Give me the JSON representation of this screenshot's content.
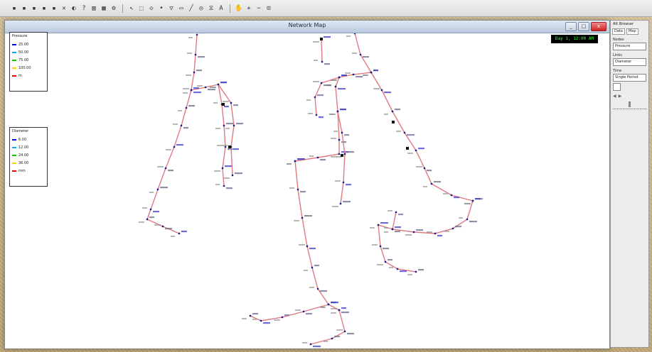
{
  "toolbar": {
    "icons": [
      "new-icon",
      "open-icon",
      "save-icon",
      "print-icon",
      "copy-icon",
      "delete-icon",
      "find-icon",
      "query-icon",
      "graph-icon",
      "table-icon",
      "options-icon",
      "pointer-icon",
      "select-region-icon",
      "select-vertex-icon",
      "add-junction-icon",
      "add-reservoir-icon",
      "add-tank-icon",
      "add-pipe-icon",
      "add-pump-icon",
      "add-valve-icon",
      "add-label-icon",
      "pan-icon",
      "zoom-in-icon",
      "zoom-out-icon",
      "full-extent-icon"
    ]
  },
  "map_window": {
    "title": "Network Map",
    "clock": "Day 1, 12:00 AM",
    "controls": {
      "minimize": "_",
      "maximize": "□",
      "close": "x"
    }
  },
  "legend_nodes": {
    "title": "Pressure",
    "rows": [
      "25.00",
      "50.00",
      "75.00",
      "100.00",
      "m"
    ]
  },
  "legend_links": {
    "title": "Diameter",
    "rows": [
      "6.00",
      "12.00",
      "24.00",
      "36.00",
      "mm"
    ]
  },
  "colors": {
    "pipe": "#e07a82",
    "node": "#1a1a8a",
    "label_blue": "#3b3bd0",
    "legend_swatches": [
      "#0000ff",
      "#00aaff",
      "#00cc00",
      "#ffcc00",
      "#ff0000"
    ]
  },
  "browser": {
    "title": "Att Browser",
    "tabs": [
      "Data",
      "Map"
    ],
    "nodes_label": "Nodes",
    "nodes_value": "Pressure",
    "links_label": "Links",
    "links_value": "Diameter",
    "time_label": "Time",
    "time_value": "Single Period"
  }
}
